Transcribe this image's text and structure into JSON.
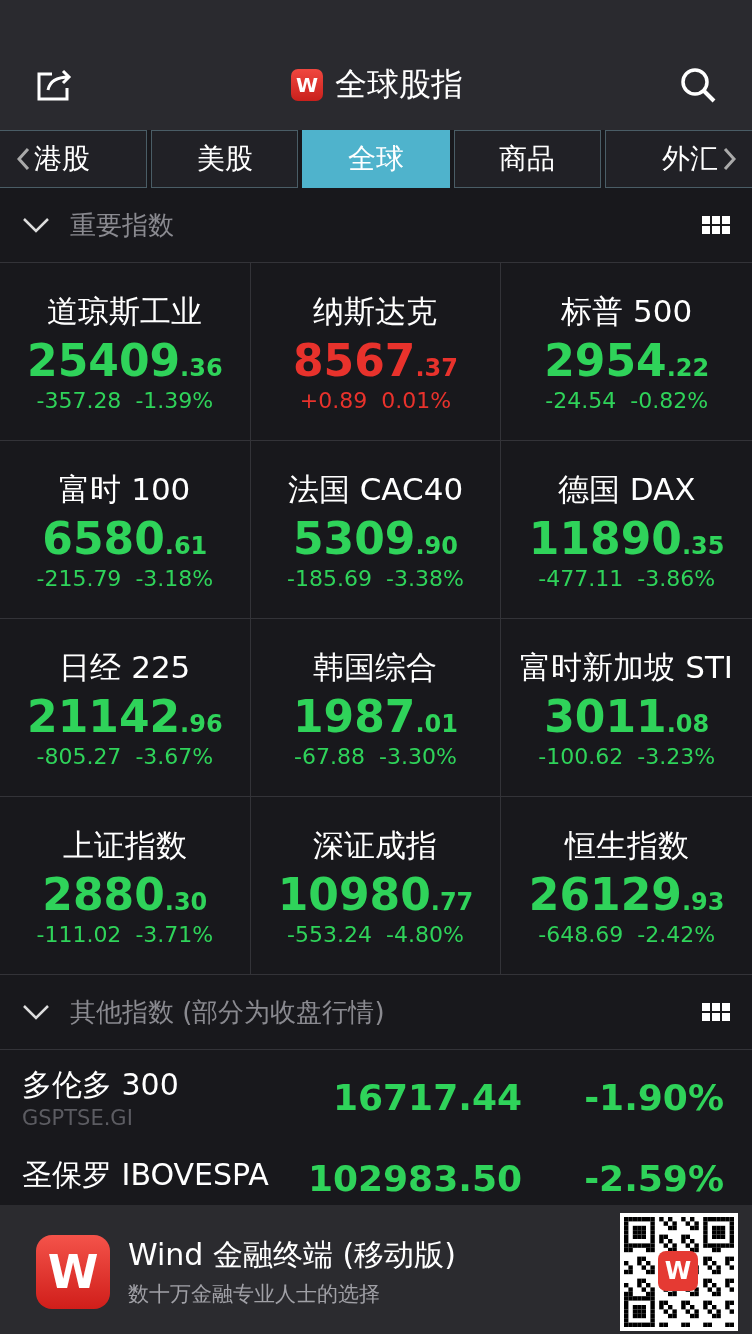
{
  "header": {
    "title": "全球股指",
    "logo": "W"
  },
  "tabs": [
    {
      "label": "港股",
      "selected": false
    },
    {
      "label": "美股",
      "selected": false
    },
    {
      "label": "全球",
      "selected": true
    },
    {
      "label": "商品",
      "selected": false
    },
    {
      "label": "外汇",
      "selected": false
    }
  ],
  "sections": [
    {
      "title": "重要指数",
      "expanded": true
    },
    {
      "title": "其他指数 (部分为收盘行情)",
      "expanded": true
    }
  ],
  "indices": [
    {
      "name": "道琼斯工业",
      "value": "25409",
      "decimals": ".36",
      "change": "-357.28",
      "percent": "-1.39%",
      "color": "#2fd35a"
    },
    {
      "name": "纳斯达克",
      "value": "8567",
      "decimals": ".37",
      "change": "+0.89",
      "percent": "0.01%",
      "color": "#e8322c"
    },
    {
      "name": "标普 500",
      "value": "2954",
      "decimals": ".22",
      "change": "-24.54",
      "percent": "-0.82%",
      "color": "#2fd35a"
    },
    {
      "name": "富时 100",
      "value": "6580",
      "decimals": ".61",
      "change": "-215.79",
      "percent": "-3.18%",
      "color": "#2fd35a"
    },
    {
      "name": "法国 CAC40",
      "value": "5309",
      "decimals": ".90",
      "change": "-185.69",
      "percent": "-3.38%",
      "color": "#2fd35a"
    },
    {
      "name": "德国 DAX",
      "value": "11890",
      "decimals": ".35",
      "change": "-477.11",
      "percent": "-3.86%",
      "color": "#2fd35a"
    },
    {
      "name": "日经 225",
      "value": "21142",
      "decimals": ".96",
      "change": "-805.27",
      "percent": "-3.67%",
      "color": "#2fd35a"
    },
    {
      "name": "韩国综合",
      "value": "1987",
      "decimals": ".01",
      "change": "-67.88",
      "percent": "-3.30%",
      "color": "#2fd35a"
    },
    {
      "name": "富时新加坡 STI",
      "value": "3011",
      "decimals": ".08",
      "change": "-100.62",
      "percent": "-3.23%",
      "color": "#2fd35a"
    },
    {
      "name": "上证指数",
      "value": "2880",
      "decimals": ".30",
      "change": "-111.02",
      "percent": "-3.71%",
      "color": "#2fd35a"
    },
    {
      "name": "深证成指",
      "value": "10980",
      "decimals": ".77",
      "change": "-553.24",
      "percent": "-4.80%",
      "color": "#2fd35a"
    },
    {
      "name": "恒生指数",
      "value": "26129",
      "decimals": ".93",
      "change": "-648.69",
      "percent": "-2.42%",
      "color": "#2fd35a"
    }
  ],
  "other_indices": [
    {
      "name": "多伦多 300",
      "code": "GSPTSE.GI",
      "value": "16717.44",
      "percent": "-1.90%",
      "color": "#2fd35a"
    },
    {
      "name": "圣保罗 IBOVESPA",
      "value": "102983.50",
      "percent": "-2.59%",
      "color": "#2fd35a"
    }
  ],
  "banner": {
    "logo": "W",
    "title": "Wind 金融终端 (移动版)",
    "subtitle": "数十万金融专业人士的选择",
    "qr_logo": "W"
  }
}
